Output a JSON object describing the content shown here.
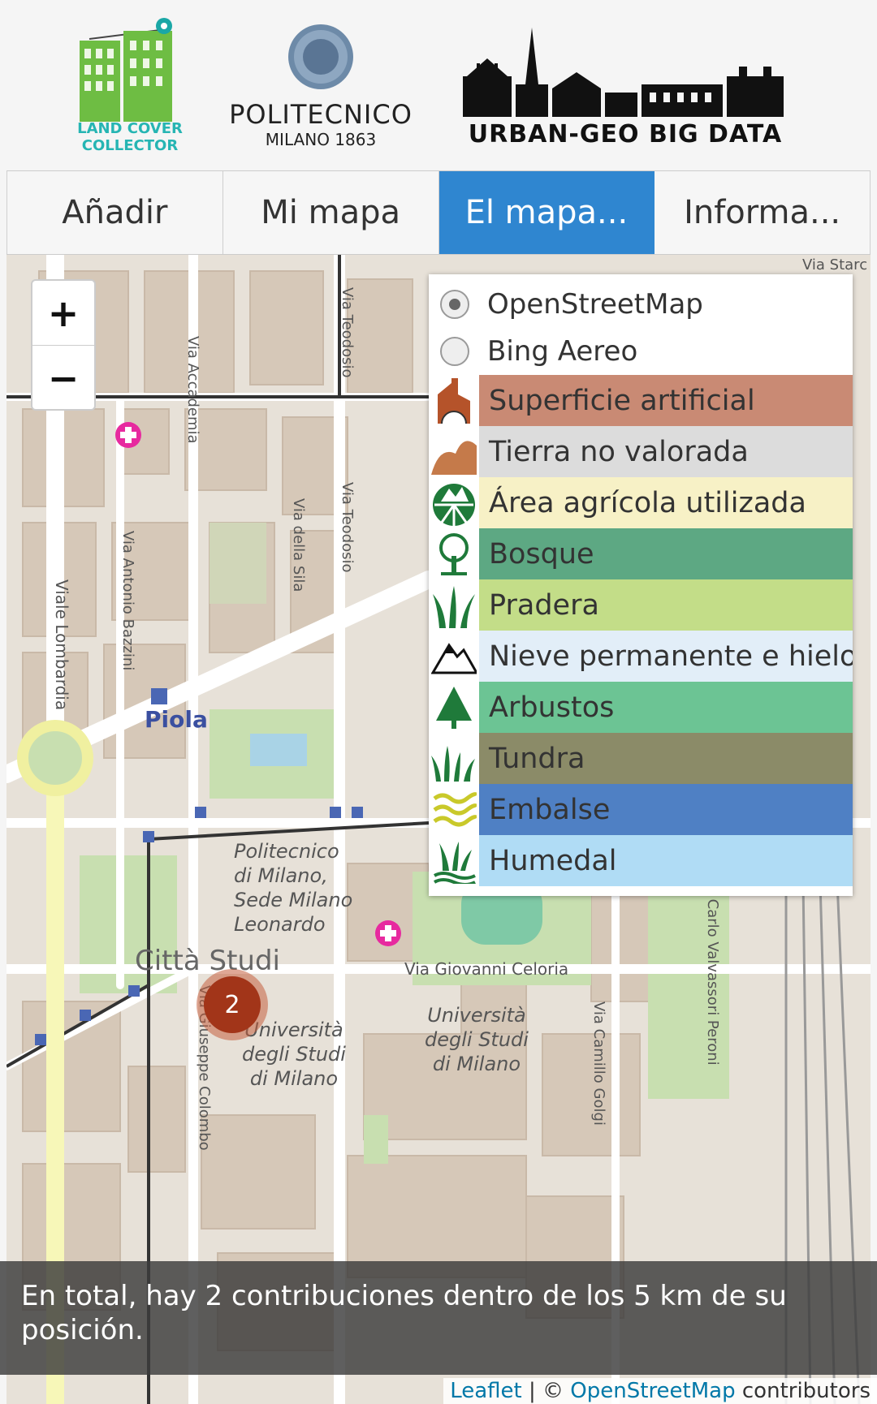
{
  "header": {
    "logo_landcover": {
      "line1": "LAND COVER",
      "line2": "COLLECTOR"
    },
    "logo_polimi": {
      "line1": "POLITECNICO",
      "line2": "MILANO 1863"
    },
    "logo_urbangeo": {
      "text": "URBAN-GEO BIG DATA"
    }
  },
  "tabs": [
    {
      "label": "Añadir"
    },
    {
      "label": "Mi mapa"
    },
    {
      "label": "El mapa..."
    },
    {
      "label": "Informa..."
    }
  ],
  "map": {
    "zoom_in": "+",
    "zoom_out": "−",
    "base_layers": [
      {
        "label": "OpenStreetMap",
        "selected": true
      },
      {
        "label": "Bing Aereo",
        "selected": false
      }
    ],
    "land_cover": [
      {
        "label": "Superficie artificial",
        "color": "#c98a74",
        "icon": "building-icon"
      },
      {
        "label": "Tierra no valorada",
        "color": "#dcdcdc",
        "icon": "bare-land-icon"
      },
      {
        "label": "Área agrícola utilizada",
        "color": "#f7f1c6",
        "icon": "agriculture-icon"
      },
      {
        "label": "Bosque",
        "color": "#5da883",
        "icon": "forest-icon"
      },
      {
        "label": "Pradera",
        "color": "#c3dd88",
        "icon": "grass-icon"
      },
      {
        "label": "Nieve permanente e hielo",
        "color": "#e2eef8",
        "icon": "mountain-icon"
      },
      {
        "label": "Arbustos",
        "color": "#6cc494",
        "icon": "shrub-icon"
      },
      {
        "label": "Tundra",
        "color": "#8b8b68",
        "icon": "tundra-icon"
      },
      {
        "label": "Embalse",
        "color": "#4f80c4",
        "icon": "water-icon"
      },
      {
        "label": "Humedal",
        "color": "#b0dcf5",
        "icon": "wetland-icon"
      }
    ],
    "cluster_count": "2",
    "street_labels": {
      "piola": "Piola",
      "citta_studi": "Città Studi",
      "politecnico": [
        "Politecnico",
        "di Milano,",
        "Sede Milano",
        "Leonardo"
      ],
      "unimi1": [
        "Università",
        "degli Studi",
        "di Milano"
      ],
      "unimi2": [
        "Università",
        "degli Studi",
        "di Milano"
      ],
      "via_celoria": "Via Giovanni Celoria",
      "via_accademia": "Via Accademia",
      "via_teodosio": "Via Teodosio",
      "via_della_sila": "Via della Sila",
      "via_bazzini": "Via Antonio Bazzini",
      "viale_lombardia": "Viale Lombardia",
      "via_colombo": "Via Giuseppe Colombo",
      "via_golgi": "Via Camillo Golgi",
      "via_valvassori": "Via Carlo Valvassori Peroni",
      "via_stard": "Via Starc"
    }
  },
  "info_text": "En total, hay 2 contribuciones dentro de los 5 km de su posición.",
  "attribution": {
    "leaflet": "Leaflet",
    "sep": " | © ",
    "osm": "OpenStreetMap",
    "suffix": " contributors"
  }
}
